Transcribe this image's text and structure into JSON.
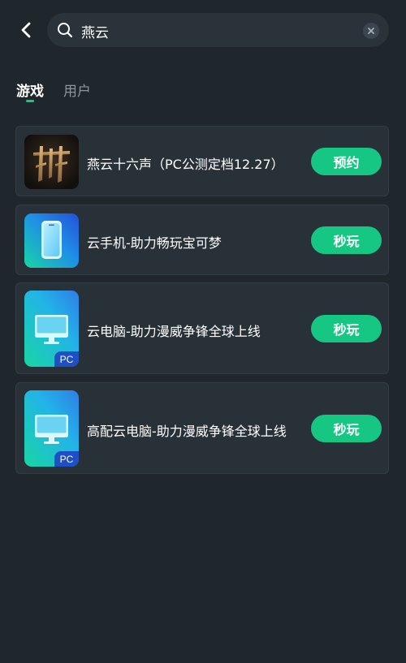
{
  "search": {
    "query": "燕云"
  },
  "tabs": [
    {
      "label": "游戏",
      "active": true
    },
    {
      "label": "用户",
      "active": false
    }
  ],
  "results": [
    {
      "title": "燕云十六声（PC公测定档12.27）",
      "button": "预约"
    },
    {
      "title": "云手机-助力畅玩宝可梦",
      "button": "秒玩"
    },
    {
      "title": "云电脑-助力漫威争锋全球上线",
      "button": "秒玩",
      "tag": "PC"
    },
    {
      "title": "高配云电脑-助力漫威争锋全球上线",
      "button": "秒玩",
      "tag": "PC"
    }
  ],
  "colors": {
    "background": "#1f262c",
    "card": "#283038",
    "accent": "#16c784",
    "inactive_text": "#8d959c"
  },
  "icons": [
    "back-arrow-icon",
    "search-icon",
    "clear-icon",
    "game-logo-icon",
    "phone-icon",
    "monitor-icon"
  ]
}
